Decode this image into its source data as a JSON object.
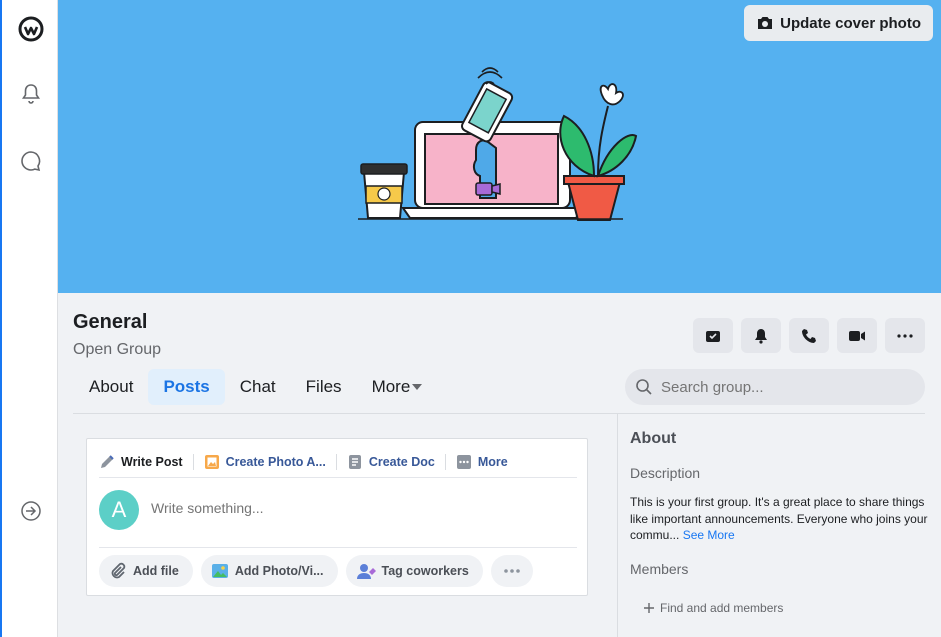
{
  "cover": {
    "update_label": "Update cover photo"
  },
  "group": {
    "name": "General",
    "type": "Open Group"
  },
  "tabs": [
    {
      "label": "About"
    },
    {
      "label": "Posts"
    },
    {
      "label": "Chat"
    },
    {
      "label": "Files"
    },
    {
      "label": "More"
    }
  ],
  "search": {
    "placeholder": "Search group..."
  },
  "composer": {
    "tabs": [
      {
        "label": "Write Post"
      },
      {
        "label": "Create Photo A..."
      },
      {
        "label": "Create Doc"
      },
      {
        "label": "More"
      }
    ],
    "avatar_letter": "A",
    "placeholder": "Write something...",
    "buttons": [
      {
        "label": "Add file"
      },
      {
        "label": "Add Photo/Vi..."
      },
      {
        "label": "Tag coworkers"
      }
    ]
  },
  "about": {
    "title": "About",
    "description_label": "Description",
    "description": "This is your first group. It's a great place to share things like important announcements. Everyone who joins your commu...",
    "see_more": "See More",
    "members_label": "Members",
    "find_members": "Find and add members"
  },
  "colors": {
    "cover": "#55b1f0",
    "accent": "#1877f2",
    "avatar": "#5ccfc7"
  }
}
